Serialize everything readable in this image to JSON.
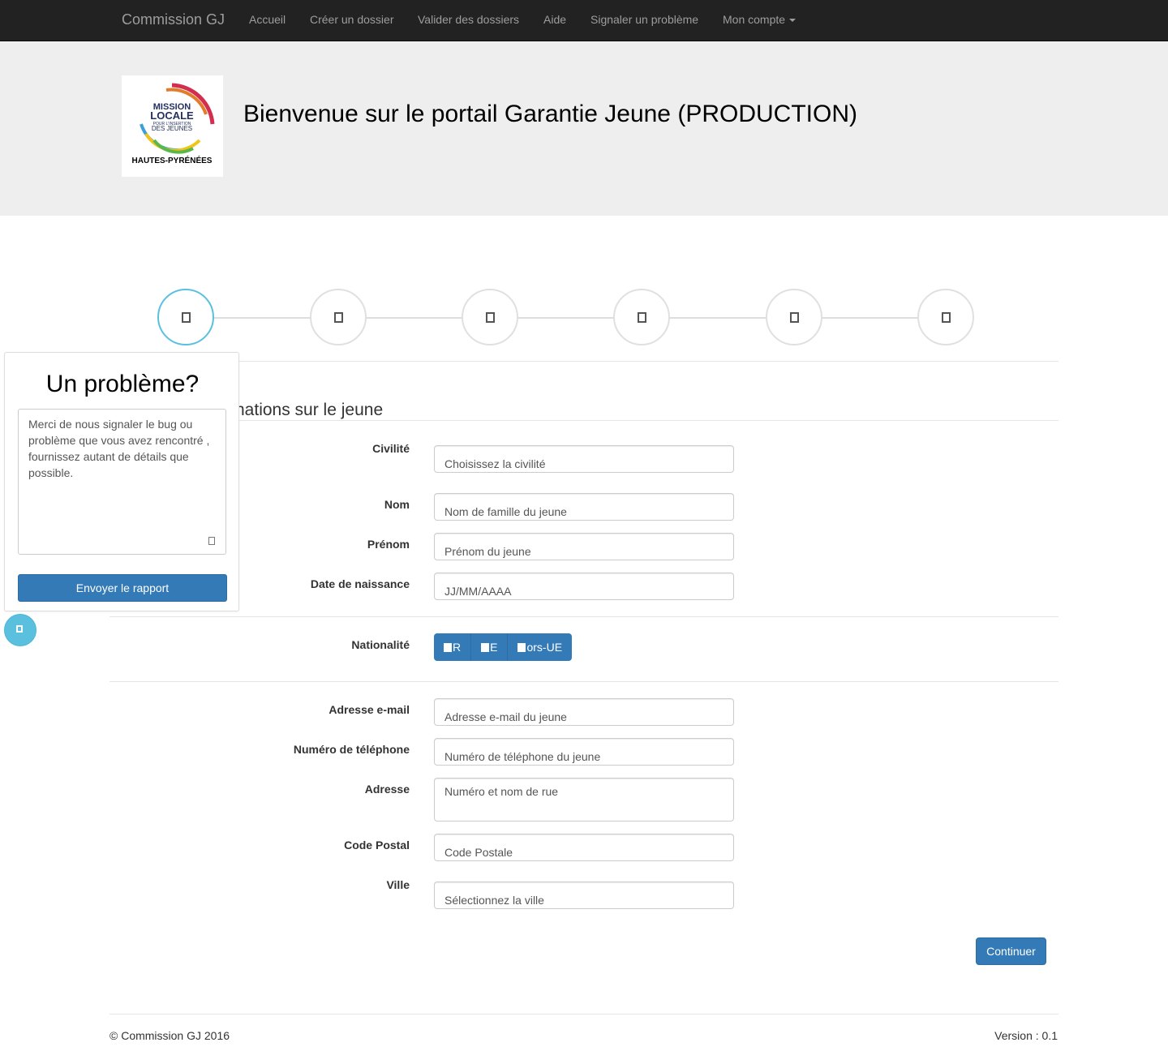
{
  "navbar": {
    "brand": "Commission GJ",
    "links": [
      "Accueil",
      "Créer un dossier",
      "Valider des dossiers",
      "Aide",
      "Signaler un problème"
    ],
    "account": "Mon compte"
  },
  "header": {
    "logo": {
      "line1": "MISSION",
      "line2": "LOCALE",
      "line3": "POUR L'INSERTION",
      "line4": "DES JEUNES",
      "region": "HAUTES-PYRÉNÉES"
    },
    "title": "Bienvenue sur le portail Garantie Jeune (PRODUCTION)"
  },
  "stepper": {
    "step_count": 6,
    "active_step": 1
  },
  "form": {
    "legend": "nations sur le jeune",
    "civilite": {
      "label": "Civilité",
      "value": "Choisissez la civilité"
    },
    "nom": {
      "label": "Nom",
      "placeholder": "Nom de famille du jeune"
    },
    "prenom": {
      "label": "Prénom",
      "placeholder": "Prénom du jeune"
    },
    "date_naissance": {
      "label": "Date de naissance",
      "placeholder": "JJ/MM/AAAA"
    },
    "nationalite": {
      "label": "Nationalité",
      "options": [
        "R",
        "E",
        "ors-UE"
      ]
    },
    "email": {
      "label": "Adresse e-mail",
      "placeholder": "Adresse e-mail du jeune"
    },
    "telephone": {
      "label": "Numéro de téléphone",
      "placeholder": "Numéro de téléphone du jeune"
    },
    "adresse": {
      "label": "Adresse",
      "placeholder": "Numéro et nom de rue"
    },
    "code_postal": {
      "label": "Code Postal",
      "placeholder": "Code Postale"
    },
    "ville": {
      "label": "Ville",
      "value": "Sélectionnez la ville"
    },
    "continue_label": "Continuer"
  },
  "problem_panel": {
    "title": "Un problème?",
    "placeholder": "Merci de nous signaler le bug ou problème que vous avez rencontré , fournissez autant de détails que possible.",
    "submit_label": "Envoyer le rapport"
  },
  "footer": {
    "copyright": "© Commission GJ 2016",
    "version": "Version : 0.1"
  },
  "colors": {
    "navbar": "#222222",
    "primary": "#337ab7",
    "info": "#5bc0de",
    "jumbotron": "#eeeeee"
  }
}
